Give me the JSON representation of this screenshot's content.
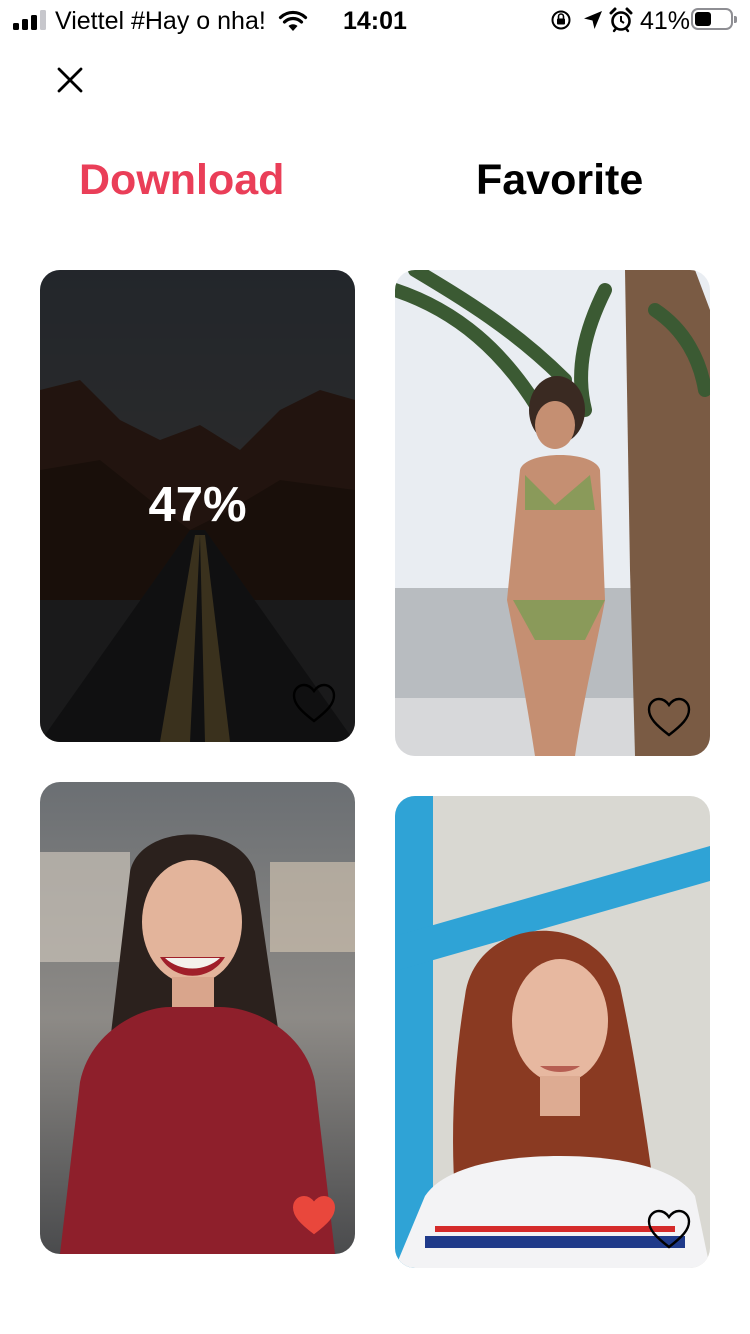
{
  "status_bar": {
    "carrier": "Viettel #Hay o nha!",
    "time": "14:01",
    "battery_percent": "41%",
    "battery_level": 0.41,
    "icons": [
      "signal-icon",
      "wifi-icon",
      "rotation-lock-icon",
      "location-icon",
      "alarm-icon",
      "battery-icon"
    ]
  },
  "header": {
    "close_icon": "close-icon"
  },
  "tabs": [
    {
      "label": "Download",
      "active": true
    },
    {
      "label": "Favorite",
      "active": false
    }
  ],
  "colors": {
    "accent": "#ea3e58",
    "heart_filled": "#e9473c",
    "text": "#000000",
    "background": "#ffffff"
  },
  "cards": [
    {
      "kind": "road-photo",
      "download_progress": "47%",
      "progress_value": 0.47,
      "favorited": false
    },
    {
      "kind": "beach-photo",
      "favorited": false
    },
    {
      "kind": "smiling-woman-photo",
      "favorited": true
    },
    {
      "kind": "redhead-woman-photo",
      "favorited": false
    }
  ]
}
